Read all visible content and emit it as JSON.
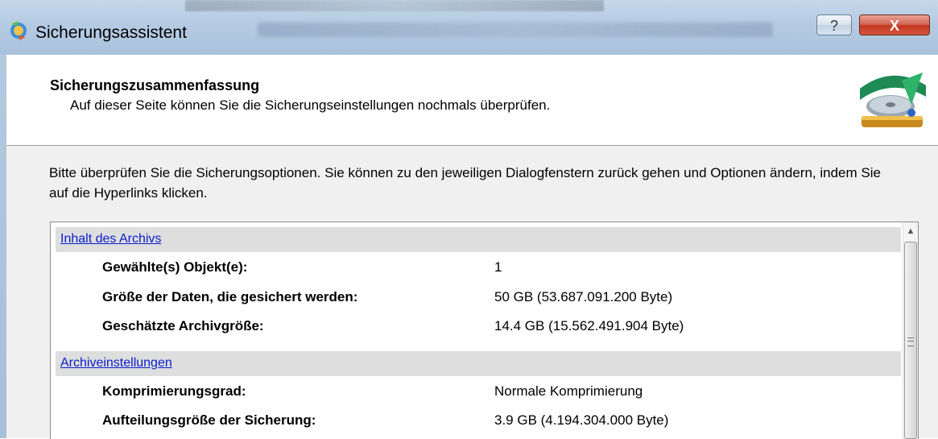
{
  "window": {
    "title": "Sicherungsassistent",
    "help_label": "?",
    "close_label": "X"
  },
  "header": {
    "title": "Sicherungszusammenfassung",
    "subtitle": "Auf dieser Seite können Sie die Sicherungseinstellungen nochmals überprüfen."
  },
  "intro": "Bitte überprüfen Sie die Sicherungsoptionen. Sie können zu den jeweiligen Dialogfenstern zurück gehen und Optionen ändern, indem Sie auf die Hyperlinks klicken.",
  "sections": [
    {
      "link": "Inhalt des Archivs",
      "rows": [
        {
          "label": "Gewählte(s) Objekt(e):",
          "value": "1"
        },
        {
          "label": "Größe der Daten, die gesichert werden:",
          "value": "50 GB (53.687.091.200 Byte)"
        },
        {
          "label": "Geschätzte Archivgröße:",
          "value": "14.4 GB (15.562.491.904 Byte)"
        }
      ]
    },
    {
      "link": "Archiveinstellungen",
      "rows": [
        {
          "label": "Komprimierungsgrad:",
          "value": "Normale Komprimierung"
        },
        {
          "label": "Aufteilungsgröße der Sicherung:",
          "value": "3.9 GB (4.194.304.000 Byte)"
        }
      ]
    }
  ],
  "icons": {
    "app": "backup-wizard-icon",
    "header": "disc-drive-graphic",
    "scroll_up": "chevron-up-icon"
  },
  "colors": {
    "link": "#0a1dcc",
    "section_bg": "#dedede",
    "close_button": "#c4371f"
  }
}
